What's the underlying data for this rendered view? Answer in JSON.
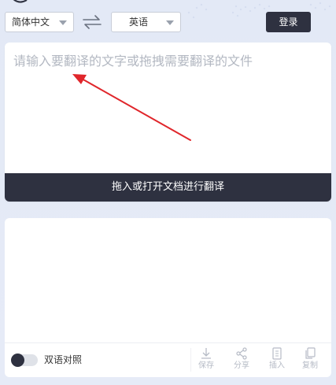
{
  "header": {
    "source_lang": "简体中文",
    "target_lang": "英语",
    "login_label": "登录"
  },
  "source": {
    "placeholder": "请输入要翻译的文字或拖拽需要翻译的文件",
    "upload_label": "拖入或打开文档进行翻译"
  },
  "result": {
    "bilingual_label": "双语对照",
    "actions": {
      "save": "保存",
      "share": "分享",
      "insert": "插入",
      "copy": "复制"
    }
  },
  "colors": {
    "dark": "#2e3140",
    "annotation_arrow": "#e0262b"
  }
}
